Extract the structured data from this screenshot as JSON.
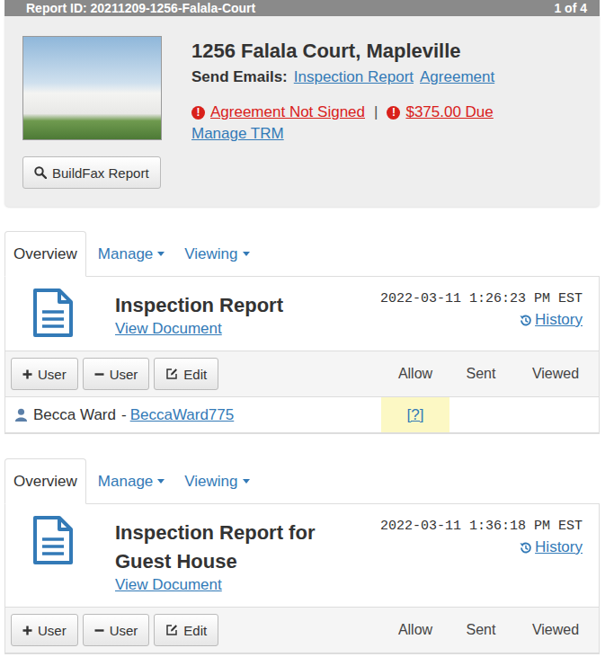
{
  "header": {
    "report_id": "Report ID: 20211209-1256-Falala-Court",
    "pager": "1 of 4"
  },
  "property": {
    "address": "1256 Falala Court, Mapleville",
    "send_emails_label": "Send Emails:",
    "email_links": [
      "Inspection Report",
      "Agreement"
    ],
    "alerts": [
      {
        "icon": "!",
        "text": "Agreement Not Signed"
      },
      {
        "icon": "!",
        "text": "$375.00 Due"
      }
    ],
    "separator": "|",
    "manage_link": "Manage TRM",
    "buildfax_button": "BuildFax Report"
  },
  "reports": [
    {
      "tabs": [
        {
          "label": "Overview",
          "selected": true,
          "dropdown": false
        },
        {
          "label": "Manage",
          "selected": false,
          "dropdown": true
        },
        {
          "label": "Viewing",
          "selected": false,
          "dropdown": true
        }
      ],
      "title": "Inspection Report",
      "view_link": "View Document",
      "timestamp": "2022-03-11 1:26:23 PM EST",
      "history_link": "History",
      "buttons": [
        {
          "kind": "add",
          "label": "User"
        },
        {
          "kind": "remove",
          "label": "User"
        },
        {
          "kind": "edit",
          "label": "Edit"
        }
      ],
      "columns": [
        "Allow",
        "Sent",
        "Viewed"
      ],
      "users": [
        {
          "name": "Becca Ward",
          "separator": "-",
          "username": "BeccaWard775",
          "allow": "[?]"
        }
      ]
    },
    {
      "tabs": [
        {
          "label": "Overview",
          "selected": true,
          "dropdown": false
        },
        {
          "label": "Manage",
          "selected": false,
          "dropdown": true
        },
        {
          "label": "Viewing",
          "selected": false,
          "dropdown": true
        }
      ],
      "title": "Inspection Report for Guest House",
      "view_link": "View Document",
      "timestamp": "2022-03-11 1:36:18 PM EST",
      "history_link": "History",
      "buttons": [
        {
          "kind": "add",
          "label": "User"
        },
        {
          "kind": "remove",
          "label": "User"
        },
        {
          "kind": "edit",
          "label": "Edit"
        }
      ],
      "columns": [
        "Allow",
        "Sent",
        "Viewed"
      ],
      "users": []
    }
  ]
}
